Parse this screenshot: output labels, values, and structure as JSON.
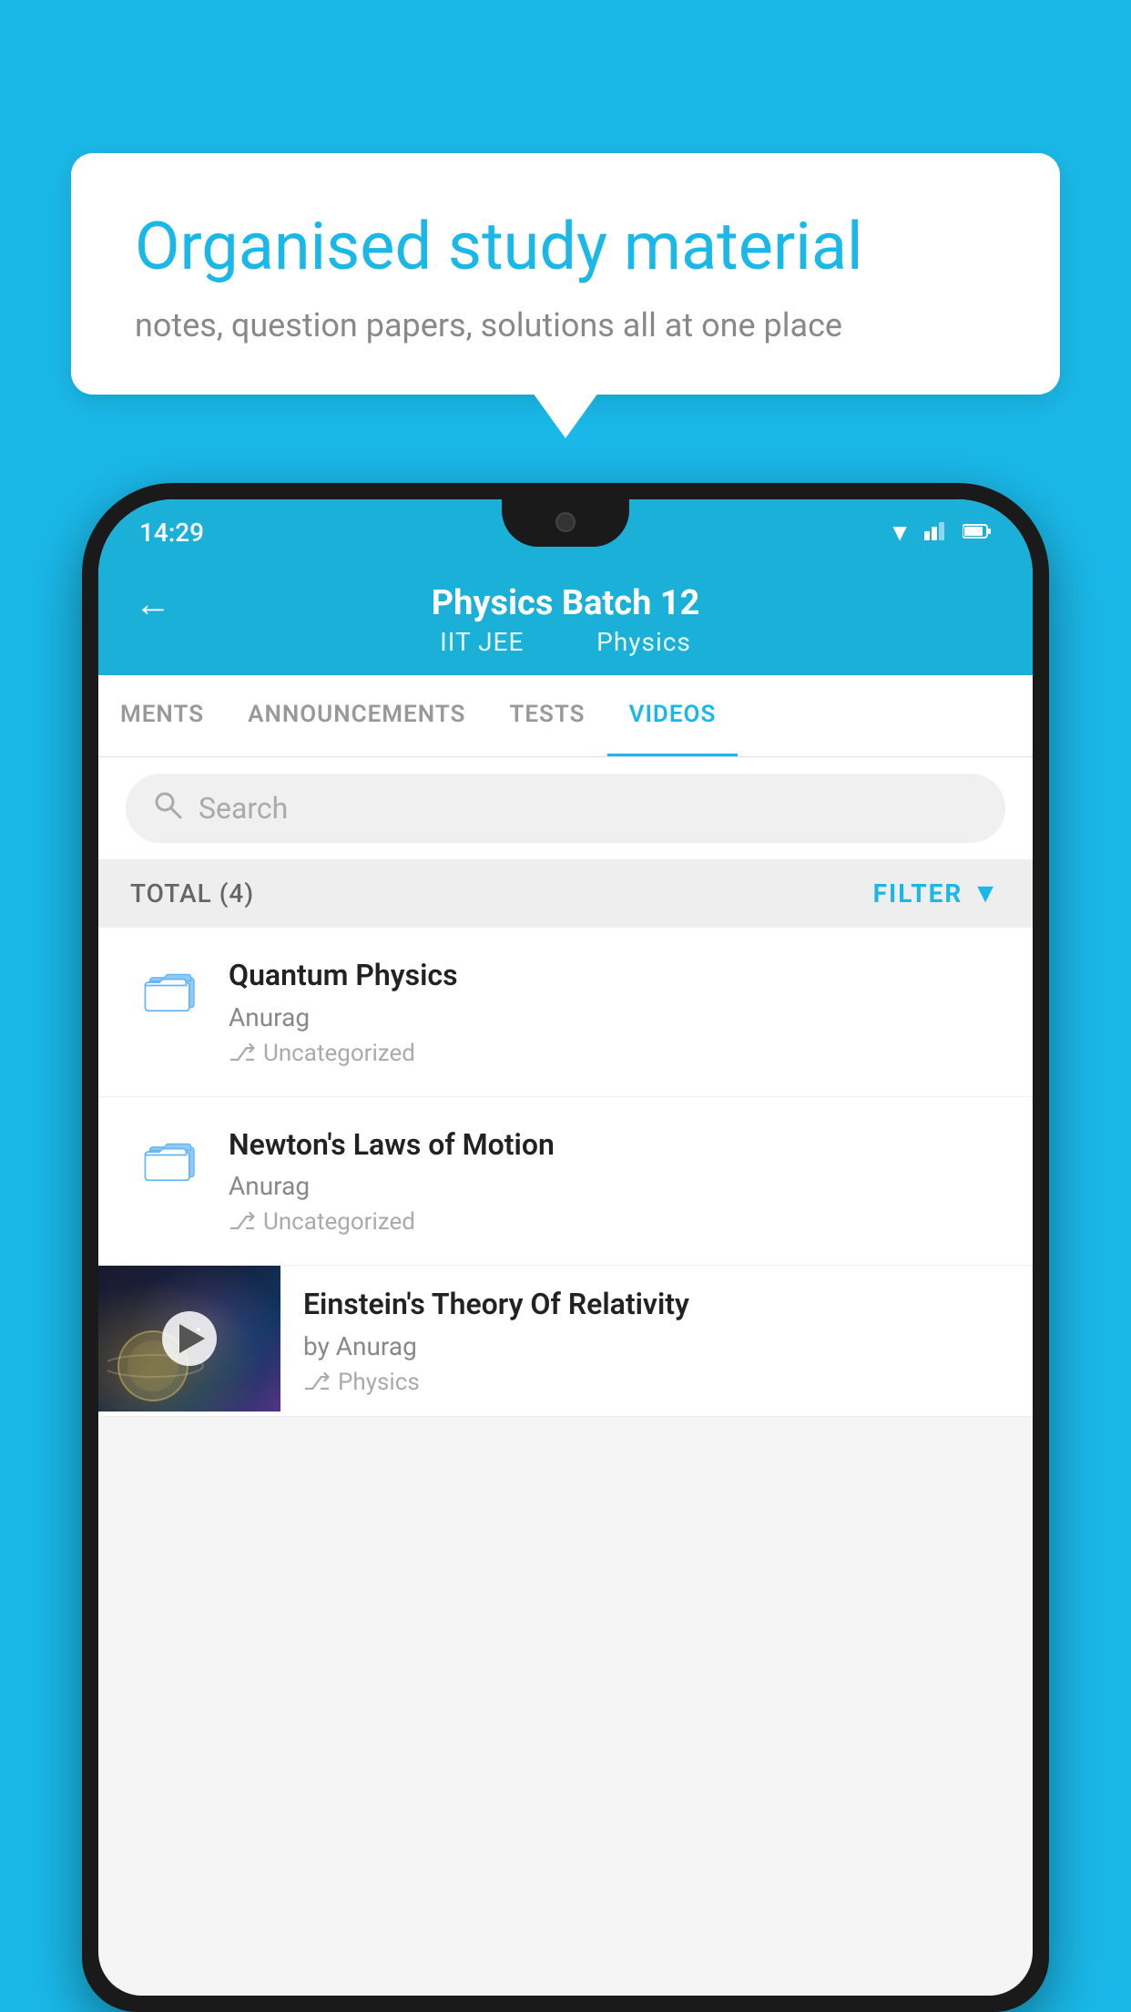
{
  "background_color": "#1ab8e8",
  "bubble": {
    "title": "Organised study material",
    "subtitle": "notes, question papers, solutions all at one place"
  },
  "status_bar": {
    "time": "14:29",
    "wifi_icon": "▼",
    "signal_icon": "▲",
    "battery_icon": "▮"
  },
  "header": {
    "back_label": "←",
    "title": "Physics Batch 12",
    "subtitle_part1": "IIT JEE",
    "subtitle_part2": "Physics"
  },
  "tabs": [
    {
      "label": "MENTS",
      "active": false
    },
    {
      "label": "ANNOUNCEMENTS",
      "active": false
    },
    {
      "label": "TESTS",
      "active": false
    },
    {
      "label": "VIDEOS",
      "active": true
    }
  ],
  "search": {
    "placeholder": "Search"
  },
  "filter_bar": {
    "total_label": "TOTAL (4)",
    "filter_label": "FILTER"
  },
  "items": [
    {
      "type": "folder",
      "title": "Quantum Physics",
      "author": "Anurag",
      "tag": "Uncategorized"
    },
    {
      "type": "folder",
      "title": "Newton's Laws of Motion",
      "author": "Anurag",
      "tag": "Uncategorized"
    },
    {
      "type": "video",
      "title": "Einstein's Theory Of Relativity",
      "author": "by Anurag",
      "tag": "Physics"
    }
  ]
}
